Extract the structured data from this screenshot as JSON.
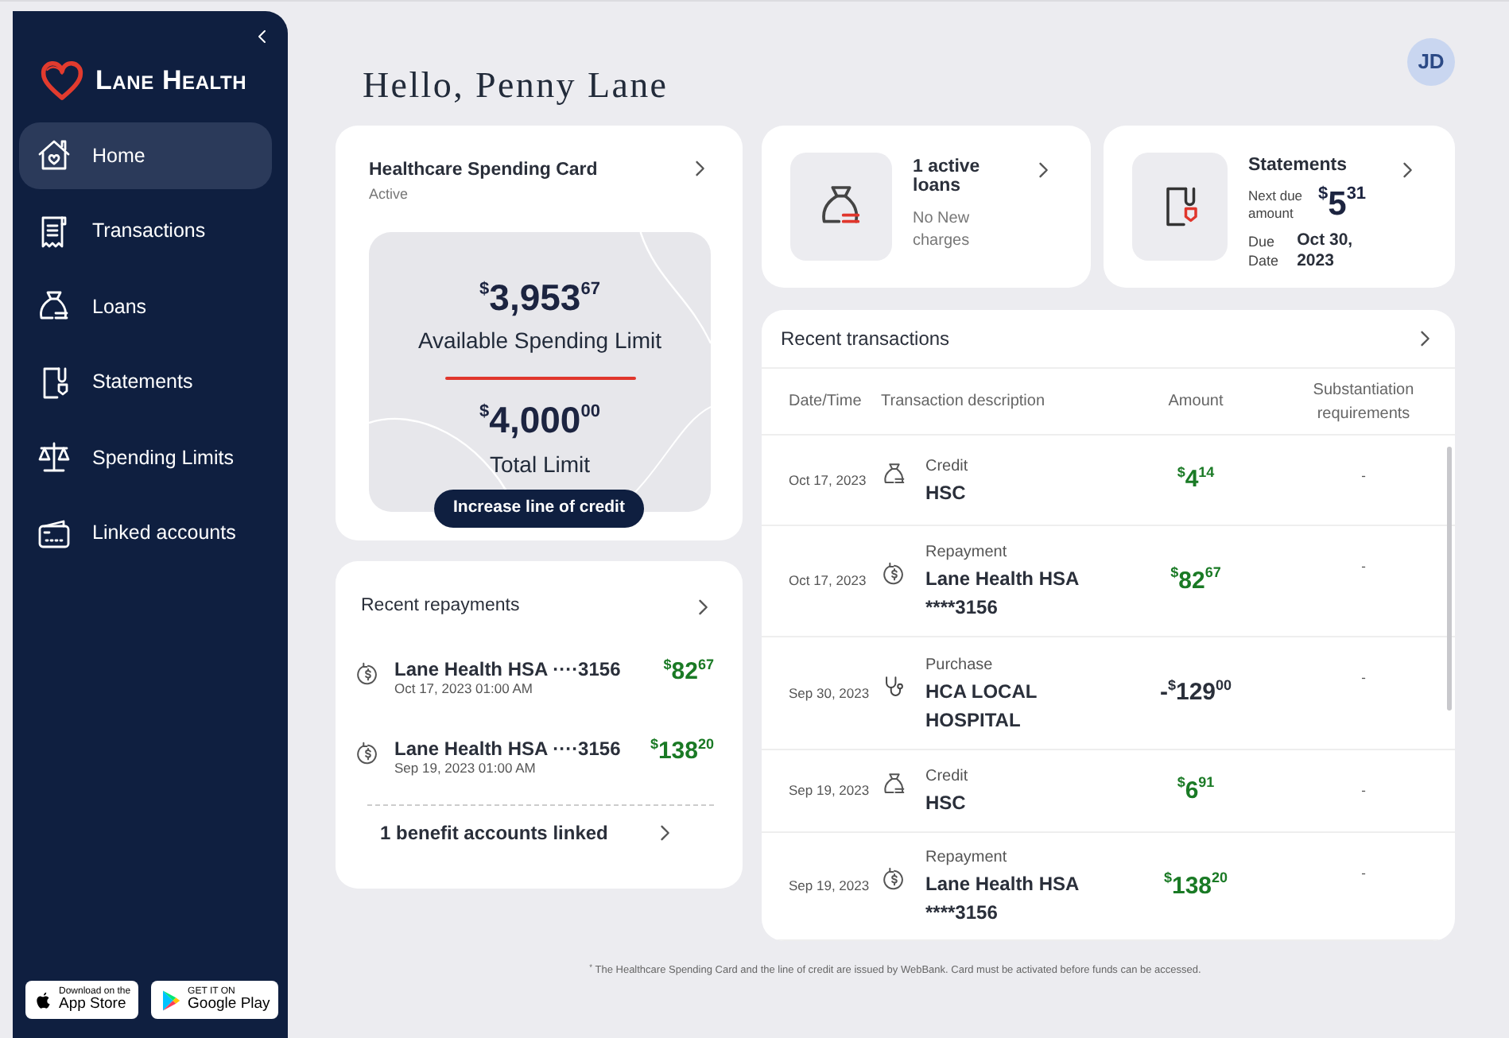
{
  "sidebar": {
    "brand": "Lane Health",
    "items": [
      {
        "label": "Home",
        "selected": true
      },
      {
        "label": "Transactions",
        "selected": false
      },
      {
        "label": "Loans",
        "selected": false
      },
      {
        "label": "Statements",
        "selected": false
      },
      {
        "label": "Spending Limits",
        "selected": false
      },
      {
        "label": "Linked accounts",
        "selected": false
      }
    ],
    "store_badges": [
      {
        "kind": "apple",
        "small": "Download on the",
        "big": "App Store"
      },
      {
        "kind": "google",
        "small": "GET IT ON",
        "big": "Google Play"
      }
    ]
  },
  "avatar": "JD",
  "greeting": "Hello, Penny Lane",
  "spending_card": {
    "title": "Healthcare Spending Card",
    "status": "Active",
    "available": {
      "currency": "$",
      "whole": "3,953",
      "cents": "67"
    },
    "available_label": "Available Spending Limit",
    "total": {
      "currency": "$",
      "whole": "4,000",
      "cents": "00"
    },
    "total_label": "Total Limit",
    "button": "Increase line of credit"
  },
  "loans_card": {
    "title": "1 active loans",
    "subtitle": "No New charges"
  },
  "statements_card": {
    "title": "Statements",
    "due_amount_label": "Next due amount",
    "due_amount": {
      "currency": "$",
      "whole": "5",
      "cents": "31"
    },
    "due_date_label": "Due Date",
    "due_date": "Oct 30, 2023"
  },
  "recent_repayments": {
    "title": "Recent repayments",
    "items": [
      {
        "name": "Lane Health HSA ····3156",
        "date": "Oct 17, 2023 01:00 AM",
        "amount": {
          "currency": "$",
          "whole": "82",
          "cents": "67"
        }
      },
      {
        "name": "Lane Health HSA ····3156",
        "date": "Sep 19, 2023 01:00 AM",
        "amount": {
          "currency": "$",
          "whole": "138",
          "cents": "20"
        }
      }
    ],
    "link": "1 benefit accounts linked"
  },
  "recent_transactions": {
    "title": "Recent transactions",
    "columns": [
      "Date/Time",
      "Transaction description",
      "Amount",
      "Substantiation requirements"
    ],
    "rows": [
      {
        "date": "Oct 17, 2023",
        "kind": "loan",
        "type": "Credit",
        "description": "HSC",
        "amount": {
          "currency": "$",
          "whole": "4",
          "cents": "14"
        },
        "substantiation": "-"
      },
      {
        "date": "Oct 17, 2023",
        "kind": "repayment",
        "type": "Repayment",
        "description": "Lane Health HSA ****3156",
        "amount": {
          "currency": "$",
          "whole": "82",
          "cents": "67"
        },
        "substantiation": "-"
      },
      {
        "date": "Sep 30, 2023",
        "kind": "purchase",
        "type": "Purchase",
        "description": "HCA LOCAL HOSPITAL",
        "amount": {
          "sign": "-",
          "currency": "$",
          "whole": "129",
          "cents": "00"
        },
        "substantiation": "-"
      },
      {
        "date": "Sep 19, 2023",
        "kind": "loan",
        "type": "Credit",
        "description": "HSC",
        "amount": {
          "currency": "$",
          "whole": "6",
          "cents": "91"
        },
        "substantiation": "-"
      },
      {
        "date": "Sep 19, 2023",
        "kind": "repayment",
        "type": "Repayment",
        "description": "Lane Health HSA ****3156",
        "amount": {
          "currency": "$",
          "whole": "138",
          "cents": "20"
        },
        "substantiation": "-"
      }
    ]
  },
  "footnote": "$^{*}$ The Healthcare Spending Card and the line of credit are issued by WebBank. Card must be activated before funds can be accessed."
}
